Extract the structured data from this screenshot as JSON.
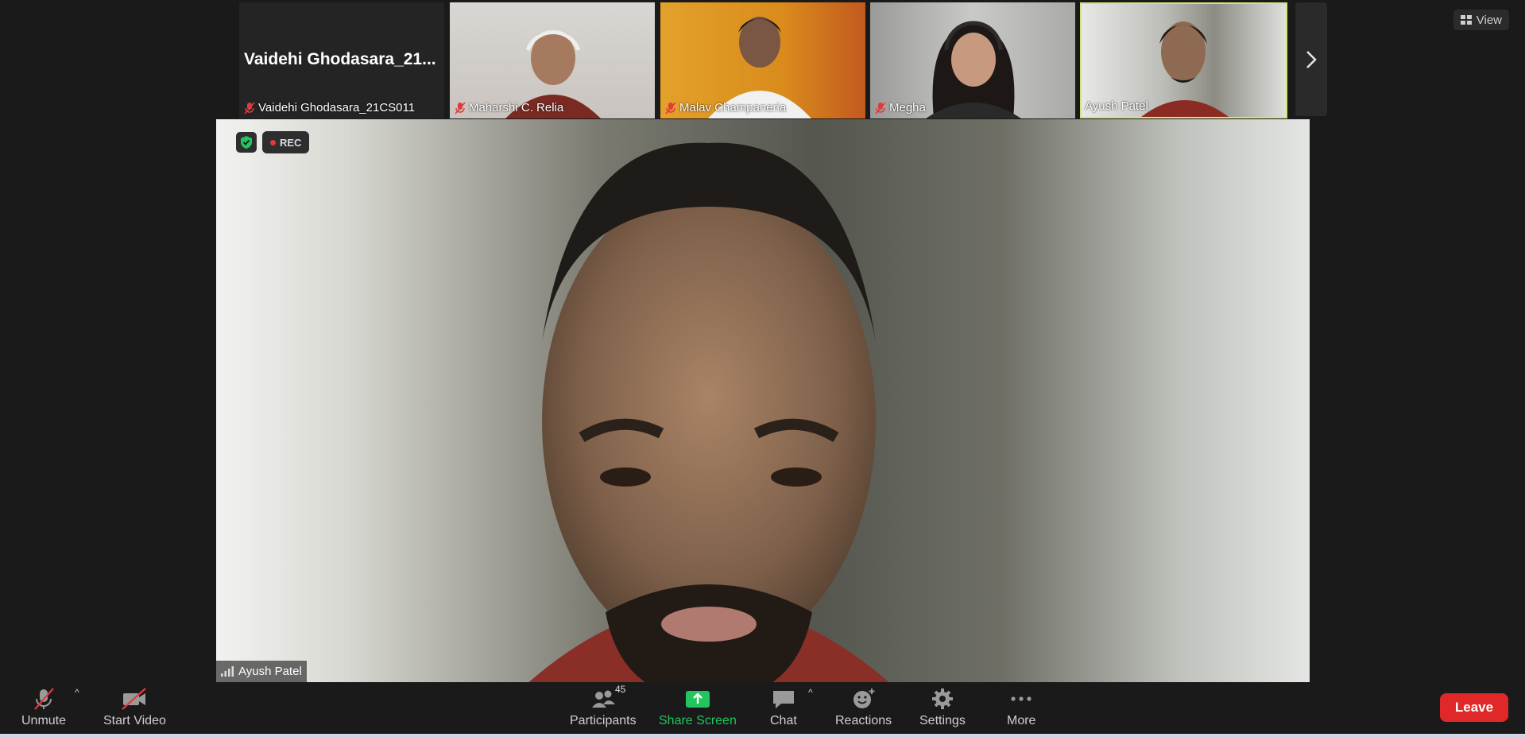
{
  "top_strip": {
    "first_tile_big_name": "Vaidehi Ghodasara_21...",
    "tiles": [
      {
        "name": "Vaidehi Ghodasara_21CS011",
        "muted": true
      },
      {
        "name": "Maharshi C. Relia",
        "muted": true
      },
      {
        "name": "Malav Champaneria",
        "muted": true
      },
      {
        "name": "Megha",
        "muted": true
      },
      {
        "name": "Ayush Patel",
        "muted": false
      }
    ],
    "view_label": "View"
  },
  "main_video": {
    "rec_label": "REC",
    "speaker_name": "Ayush Patel"
  },
  "toolbar": {
    "unmute_label": "Unmute",
    "start_video_label": "Start Video",
    "participants_label": "Participants",
    "participants_count": "45",
    "share_screen_label": "Share Screen",
    "chat_label": "Chat",
    "reactions_label": "Reactions",
    "settings_label": "Settings",
    "more_label": "More",
    "leave_label": "Leave"
  },
  "colors": {
    "leave_red": "#e02828",
    "share_green": "#22c55e",
    "active_tile_border": "#d8e27a",
    "rec_dot": "#e03a3a"
  }
}
